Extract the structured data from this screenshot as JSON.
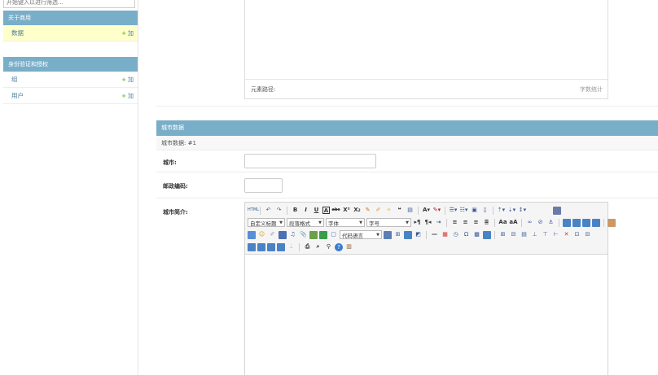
{
  "sidebar": {
    "filter_placeholder": "开始键入以进行筛选...",
    "modules": [
      {
        "caption": "关于商用",
        "models": [
          {
            "name": "数据",
            "add_label": "加",
            "highlighted": true
          }
        ]
      },
      {
        "caption": "身份验证和授权",
        "models": [
          {
            "name": "组",
            "add_label": "加",
            "highlighted": false
          },
          {
            "name": "用户",
            "add_label": "加",
            "highlighted": false
          }
        ]
      }
    ]
  },
  "top_editor": {
    "element_path_label": "元素路径:",
    "word_count_label": "字数统计"
  },
  "inline": {
    "caption": "城市数据",
    "subtitle": "城市数据:  #1",
    "fields": {
      "city_label": "城市:",
      "city_value": "",
      "postcode_label": "邮政编码:",
      "postcode_value": "",
      "intro_label": "城市简介:"
    }
  },
  "toolbar": {
    "row1": [
      "source",
      "undo",
      "redo",
      "bold",
      "italic",
      "underline",
      "fontborder",
      "strikethrough",
      "superscript",
      "subscript",
      "removeformat",
      "formatmatch",
      "autotypeset",
      "blockquote",
      "pasteplain",
      "forecolor",
      "backcolor",
      "insertorderedlist",
      "insertunorderedlist",
      "selectall",
      "cleardoc",
      "rowspacingtop",
      "rowspacingbottom",
      "lineheight",
      "fullscreen"
    ],
    "custom_style": "自定义标题",
    "paragraph": "段落格式",
    "font_family": "字体",
    "font_size": "字号",
    "code_language": "代码语言",
    "colors": {
      "accent": "#79aec8",
      "link": "#447e9b",
      "add": "#70bf2b",
      "highlight": "#ffffcc"
    }
  }
}
